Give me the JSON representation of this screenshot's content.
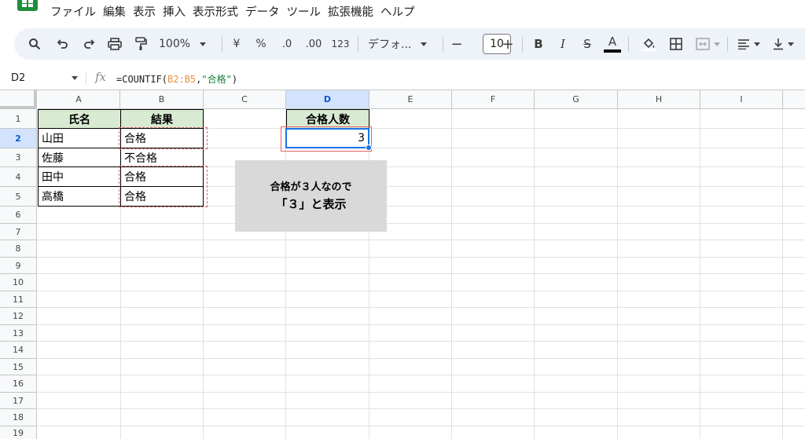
{
  "menu": [
    "ファイル",
    "編集",
    "表示",
    "挿入",
    "表示形式",
    "データ",
    "ツール",
    "拡張機能",
    "ヘルプ"
  ],
  "toolbar": {
    "zoom": "100%",
    "currency": "¥",
    "percent": "%",
    "decrease_decimal": ".0",
    "increase_decimal": ".00",
    "number_format": "123",
    "font_name": "デフォ...",
    "font_size": "10",
    "bold": "B",
    "italic": "I",
    "strikethrough": "S",
    "text_color_label": "A",
    "text_color": "#000000"
  },
  "formula_bar": {
    "name_box": "D2",
    "fx": "fx",
    "formula_prefix": "=COUNTIF(",
    "formula_range": "B2:B5",
    "formula_comma": ",",
    "formula_string": "\"合格\"",
    "formula_suffix": ")"
  },
  "columns": [
    "A",
    "B",
    "C",
    "D",
    "E",
    "F",
    "G",
    "H",
    "I"
  ],
  "rows": [
    "1",
    "2",
    "3",
    "4",
    "5",
    "6",
    "7",
    "8",
    "9",
    "10",
    "11",
    "12",
    "13",
    "14",
    "15",
    "16",
    "17",
    "18",
    "19"
  ],
  "table": {
    "header_name": "氏名",
    "header_result": "結果",
    "rows": [
      {
        "name": "山田",
        "result": "合格"
      },
      {
        "name": "佐藤",
        "result": "不合格"
      },
      {
        "name": "田中",
        "result": "合格"
      },
      {
        "name": "高橋",
        "result": "合格"
      }
    ]
  },
  "count_header": "合格人数",
  "count_value": "3",
  "callout": {
    "line1": "合格が３人なので",
    "line2": "「３」と表示"
  },
  "colors": {
    "header_fill": "#d9ead3",
    "highlight_red": "#e06666",
    "selection_blue": "#1a73e8",
    "callout_fill": "#d9d9d9"
  }
}
